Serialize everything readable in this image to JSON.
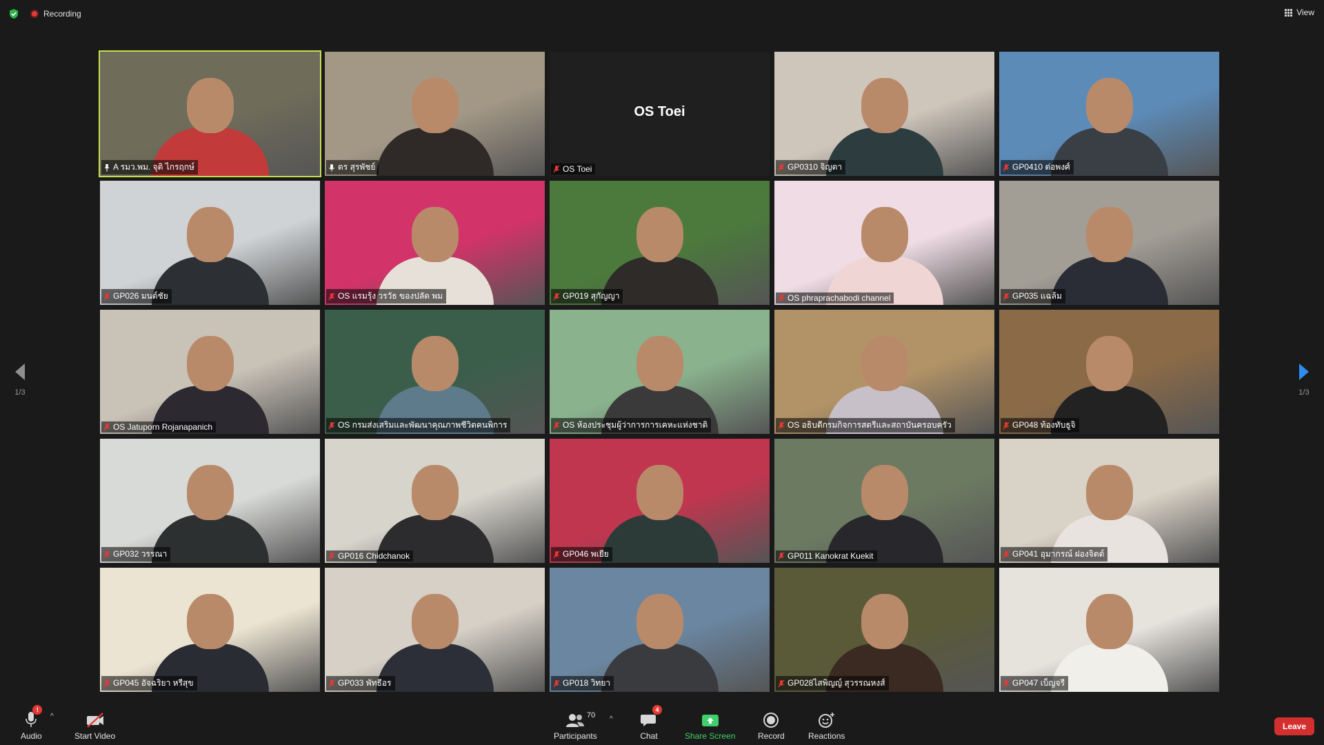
{
  "top_bar": {
    "recording_label": "Recording",
    "view_label": "View",
    "security_icon": "shield-check-icon",
    "view_icon": "grid-view-icon"
  },
  "pagination": {
    "left": "1/3",
    "right": "1/3"
  },
  "participants": [
    {
      "name": "A รมว.พม. จุติ ไกรฤกษ์",
      "status": "pinned-active"
    },
    {
      "name": "ดร สุรพัชย์",
      "status": "live"
    },
    {
      "name": "OS Toei",
      "status": "muted",
      "video": "off"
    },
    {
      "name": "GP0310 จิญดา",
      "status": "muted"
    },
    {
      "name": "GP0410 ต่อพงศ์",
      "status": "muted"
    },
    {
      "name": "GP026 มนต์ชัย",
      "status": "muted"
    },
    {
      "name": "OS แรมรุ้ง วรวัธ ของปลัด พม",
      "status": "muted"
    },
    {
      "name": "GP019 สุกัญญา",
      "status": "muted"
    },
    {
      "name": "OS phraprachabodi channel",
      "status": "muted"
    },
    {
      "name": "GP035 แฉล้ม",
      "status": "muted"
    },
    {
      "name": "OS Jatuporn Rojanapanich",
      "status": "muted"
    },
    {
      "name": "OS กรมส่งเสริมและพัฒนาคุณภาพชีวิตคนพิการ",
      "status": "muted"
    },
    {
      "name": "OS ห้องประชุมผู้ว่าการการเคหะแห่งชาติ",
      "status": "muted"
    },
    {
      "name": "OS อธิบดีกรมกิจการสตรีและสถาบันครอบครัว",
      "status": "muted"
    },
    {
      "name": "GP048 ท้องทับธูจิ",
      "status": "muted"
    },
    {
      "name": "GP032 วรรณา",
      "status": "muted"
    },
    {
      "name": "GP016 Chidchanok",
      "status": "muted"
    },
    {
      "name": "GP046 พเยีย",
      "status": "muted"
    },
    {
      "name": "GP011 Kanokrat Kuekit",
      "status": "muted"
    },
    {
      "name": "GP041 อุมากรณ์ ฝองจิตต์",
      "status": "muted"
    },
    {
      "name": "GP045 อัจฉริยา หรีสุข",
      "status": "muted"
    },
    {
      "name": "GP033 พัทธีอร",
      "status": "muted"
    },
    {
      "name": "GP018 วิทยา",
      "status": "muted"
    },
    {
      "name": "GP028ไสพิญญ์ สุวรรณหงส์",
      "status": "muted"
    },
    {
      "name": "GP047 เบ็ญจรี",
      "status": "muted"
    }
  ],
  "tile_colors": [
    [
      "#6f6c5a",
      "#c33a3a"
    ],
    [
      "#a39886",
      "#2f2a27"
    ],
    [
      "#1f1f1f",
      "#1f1f1f"
    ],
    [
      "#cfc6bb",
      "#2d3d3f"
    ],
    [
      "#5c8bb8",
      "#3a3e45"
    ],
    [
      "#cfd3d6",
      "#2c2f33"
    ],
    [
      "#d23369",
      "#e7e0d8"
    ],
    [
      "#4b7a3c",
      "#2e2b29"
    ],
    [
      "#efdce4",
      "#f0d5d5"
    ],
    [
      "#a29d95",
      "#2a2d35"
    ],
    [
      "#c9c2b7",
      "#2d2931"
    ],
    [
      "#3a5e4a",
      "#5d7b8b"
    ],
    [
      "#8ab28d",
      "#3a3a3a"
    ],
    [
      "#b29367",
      "#c7c0c8"
    ],
    [
      "#8a6a47",
      "#222222"
    ],
    [
      "#d8dad7",
      "#2d3031"
    ],
    [
      "#d6d4cb",
      "#2c2b2e"
    ],
    [
      "#c0364f",
      "#2d3b38"
    ],
    [
      "#6c7a62",
      "#28282c"
    ],
    [
      "#d9d2c6",
      "#e8e3df"
    ],
    [
      "#ece4d2",
      "#2a2c34"
    ],
    [
      "#d6d0c6",
      "#2c2f38"
    ],
    [
      "#6a86a0",
      "#3a3b3f"
    ],
    [
      "#5a5a38",
      "#3a2a22"
    ],
    [
      "#e6e2dc",
      "#f0efe9"
    ]
  ],
  "toolbar": {
    "audio_label": "Audio",
    "audio_badge": "!",
    "video_label": "Start Video",
    "participants_label": "Participants",
    "participants_count": "70",
    "chat_label": "Chat",
    "chat_badge": "4",
    "share_label": "Share Screen",
    "record_label": "Record",
    "reactions_label": "Reactions",
    "leave_label": "Leave"
  },
  "colors": {
    "active_speaker": "#c8e04c",
    "share_green": "#3fd06b",
    "leave_red": "#d32f2f",
    "nav_arrow_active": "#2e8cf0"
  }
}
